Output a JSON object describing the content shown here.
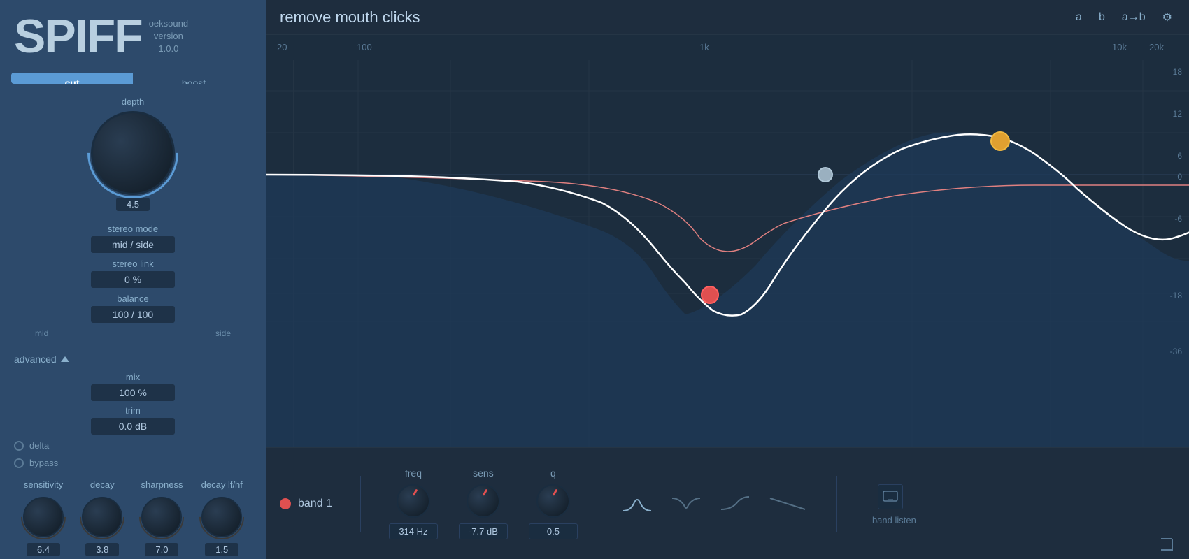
{
  "app": {
    "logo": "SPIFF",
    "brand": "oeksound",
    "version_label": "version",
    "version": "1.0.0"
  },
  "tabs": {
    "cut_label": "cut",
    "boost_label": "boost",
    "active": "cut"
  },
  "knobs": {
    "depth_label": "depth",
    "depth_value": "4.5",
    "sensitivity_label": "sensitivity",
    "sensitivity_value": "6.4",
    "decay_label": "decay",
    "decay_value": "3.8",
    "sharpness_label": "sharpness",
    "sharpness_value": "7.0",
    "decay_lf_hf_label": "decay lf/hf",
    "decay_lf_hf_value": "1.5"
  },
  "stereo": {
    "mode_label": "stereo mode",
    "mode_value": "mid / side",
    "link_label": "stereo link",
    "link_value": "0 %",
    "balance_label": "balance",
    "balance_value": "100 / 100",
    "mid_label": "mid",
    "side_label": "side"
  },
  "advanced": {
    "label": "advanced",
    "mix_label": "mix",
    "mix_value": "100 %",
    "trim_label": "trim",
    "trim_value": "0.0 dB",
    "delta_label": "delta",
    "bypass_label": "bypass"
  },
  "preset": {
    "name": "remove mouth clicks"
  },
  "toolbar": {
    "a_label": "a",
    "b_label": "b",
    "copy_label": "a→b",
    "settings_label": "⚙"
  },
  "freq_axis": {
    "labels": [
      "20",
      "100",
      "1k",
      "10k",
      "20k"
    ]
  },
  "db_axis": {
    "labels": [
      "18",
      "12",
      "6",
      "0",
      "-6",
      "-18",
      "-36"
    ]
  },
  "band": {
    "name": "band 1",
    "freq_label": "freq",
    "freq_value": "314 Hz",
    "sens_label": "sens",
    "sens_value": "-7.7 dB",
    "q_label": "q",
    "q_value": "0.5",
    "listen_label": "band listen"
  }
}
